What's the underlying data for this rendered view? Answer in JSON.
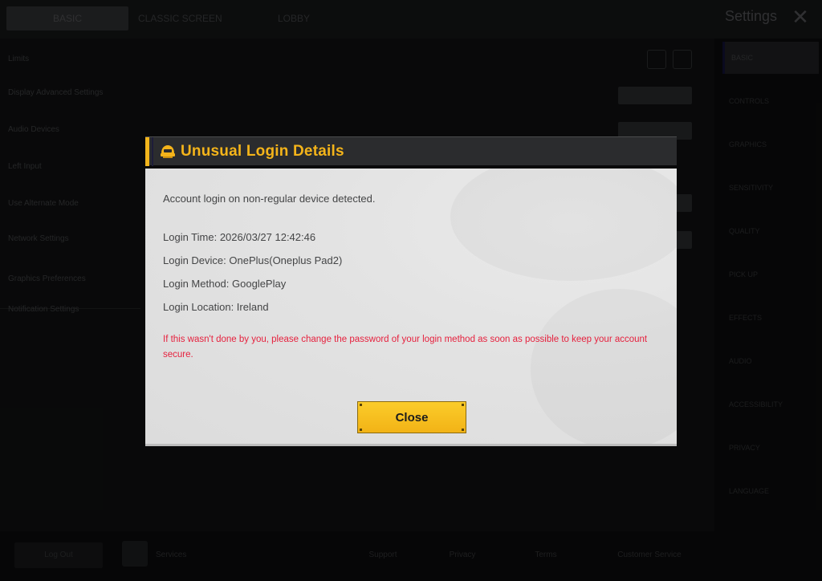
{
  "background": {
    "tabs": [
      {
        "label": "BASIC"
      },
      {
        "label": "CLASSIC SCREEN"
      },
      {
        "label": "LOBBY"
      }
    ],
    "window_title": "Settings",
    "left_rows": [
      {
        "label": "Limits"
      },
      {
        "label": "Display Advanced Settings"
      },
      {
        "label": "Audio Devices"
      },
      {
        "label": "Left Input"
      },
      {
        "label": "Use Alternate Mode"
      },
      {
        "label": "Network Settings"
      },
      {
        "label": "Graphics Preferences"
      },
      {
        "label": "Notification Settings"
      }
    ],
    "sidebar_items": [
      {
        "label": "BASIC"
      },
      {
        "label": "CONTROLS"
      },
      {
        "label": "GRAPHICS"
      },
      {
        "label": "SENSITIVITY"
      },
      {
        "label": "QUALITY"
      },
      {
        "label": "PICK UP"
      },
      {
        "label": "EFFECTS"
      },
      {
        "label": "AUDIO"
      },
      {
        "label": "ACCESSIBILITY"
      },
      {
        "label": "PRIVACY"
      },
      {
        "label": "LANGUAGE"
      }
    ],
    "bottom_buttons": [
      {
        "label": "Log Out"
      },
      {
        "label": "Services"
      },
      {
        "label": "Support"
      },
      {
        "label": "Privacy"
      },
      {
        "label": "Terms"
      },
      {
        "label": "Customer Service"
      }
    ]
  },
  "modal": {
    "title": "Unusual Login Details",
    "intro": "Account login on non-regular device detected.",
    "details": [
      {
        "text": "Login Time: 2026/03/27 12:42:46"
      },
      {
        "text": "Login Device: OnePlus(Oneplus Pad2)"
      },
      {
        "text": "Login Method: GooglePlay"
      },
      {
        "text": "Login Location: Ireland"
      }
    ],
    "warning": "If this wasn't done by you, please change the password of your login method as soon as possible to keep your account secure.",
    "close_label": "Close",
    "colors": {
      "title": "#f4b41a",
      "warning": "#e6213e",
      "button": "#f6c020",
      "header": "#2b2c2e"
    }
  }
}
